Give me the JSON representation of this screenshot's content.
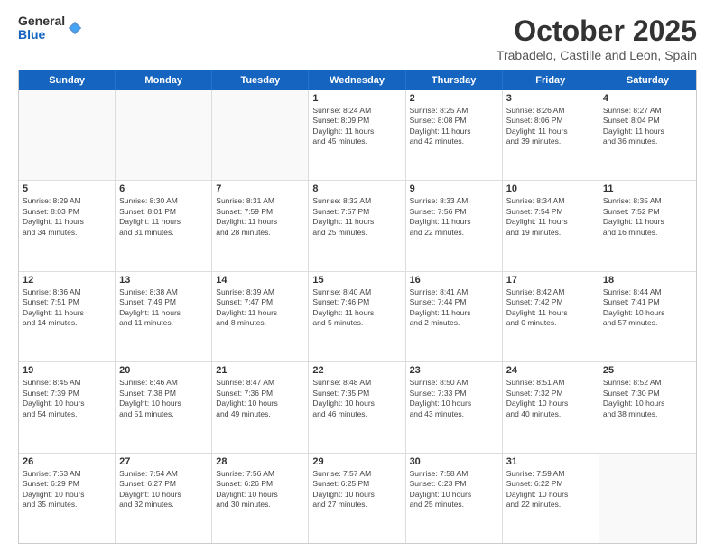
{
  "header": {
    "logo_general": "General",
    "logo_blue": "Blue",
    "month_title": "October 2025",
    "location": "Trabadelo, Castille and Leon, Spain"
  },
  "days_of_week": [
    "Sunday",
    "Monday",
    "Tuesday",
    "Wednesday",
    "Thursday",
    "Friday",
    "Saturday"
  ],
  "rows": [
    [
      {
        "day": "",
        "info": ""
      },
      {
        "day": "",
        "info": ""
      },
      {
        "day": "",
        "info": ""
      },
      {
        "day": "1",
        "info": "Sunrise: 8:24 AM\nSunset: 8:09 PM\nDaylight: 11 hours\nand 45 minutes."
      },
      {
        "day": "2",
        "info": "Sunrise: 8:25 AM\nSunset: 8:08 PM\nDaylight: 11 hours\nand 42 minutes."
      },
      {
        "day": "3",
        "info": "Sunrise: 8:26 AM\nSunset: 8:06 PM\nDaylight: 11 hours\nand 39 minutes."
      },
      {
        "day": "4",
        "info": "Sunrise: 8:27 AM\nSunset: 8:04 PM\nDaylight: 11 hours\nand 36 minutes."
      }
    ],
    [
      {
        "day": "5",
        "info": "Sunrise: 8:29 AM\nSunset: 8:03 PM\nDaylight: 11 hours\nand 34 minutes."
      },
      {
        "day": "6",
        "info": "Sunrise: 8:30 AM\nSunset: 8:01 PM\nDaylight: 11 hours\nand 31 minutes."
      },
      {
        "day": "7",
        "info": "Sunrise: 8:31 AM\nSunset: 7:59 PM\nDaylight: 11 hours\nand 28 minutes."
      },
      {
        "day": "8",
        "info": "Sunrise: 8:32 AM\nSunset: 7:57 PM\nDaylight: 11 hours\nand 25 minutes."
      },
      {
        "day": "9",
        "info": "Sunrise: 8:33 AM\nSunset: 7:56 PM\nDaylight: 11 hours\nand 22 minutes."
      },
      {
        "day": "10",
        "info": "Sunrise: 8:34 AM\nSunset: 7:54 PM\nDaylight: 11 hours\nand 19 minutes."
      },
      {
        "day": "11",
        "info": "Sunrise: 8:35 AM\nSunset: 7:52 PM\nDaylight: 11 hours\nand 16 minutes."
      }
    ],
    [
      {
        "day": "12",
        "info": "Sunrise: 8:36 AM\nSunset: 7:51 PM\nDaylight: 11 hours\nand 14 minutes."
      },
      {
        "day": "13",
        "info": "Sunrise: 8:38 AM\nSunset: 7:49 PM\nDaylight: 11 hours\nand 11 minutes."
      },
      {
        "day": "14",
        "info": "Sunrise: 8:39 AM\nSunset: 7:47 PM\nDaylight: 11 hours\nand 8 minutes."
      },
      {
        "day": "15",
        "info": "Sunrise: 8:40 AM\nSunset: 7:46 PM\nDaylight: 11 hours\nand 5 minutes."
      },
      {
        "day": "16",
        "info": "Sunrise: 8:41 AM\nSunset: 7:44 PM\nDaylight: 11 hours\nand 2 minutes."
      },
      {
        "day": "17",
        "info": "Sunrise: 8:42 AM\nSunset: 7:42 PM\nDaylight: 11 hours\nand 0 minutes."
      },
      {
        "day": "18",
        "info": "Sunrise: 8:44 AM\nSunset: 7:41 PM\nDaylight: 10 hours\nand 57 minutes."
      }
    ],
    [
      {
        "day": "19",
        "info": "Sunrise: 8:45 AM\nSunset: 7:39 PM\nDaylight: 10 hours\nand 54 minutes."
      },
      {
        "day": "20",
        "info": "Sunrise: 8:46 AM\nSunset: 7:38 PM\nDaylight: 10 hours\nand 51 minutes."
      },
      {
        "day": "21",
        "info": "Sunrise: 8:47 AM\nSunset: 7:36 PM\nDaylight: 10 hours\nand 49 minutes."
      },
      {
        "day": "22",
        "info": "Sunrise: 8:48 AM\nSunset: 7:35 PM\nDaylight: 10 hours\nand 46 minutes."
      },
      {
        "day": "23",
        "info": "Sunrise: 8:50 AM\nSunset: 7:33 PM\nDaylight: 10 hours\nand 43 minutes."
      },
      {
        "day": "24",
        "info": "Sunrise: 8:51 AM\nSunset: 7:32 PM\nDaylight: 10 hours\nand 40 minutes."
      },
      {
        "day": "25",
        "info": "Sunrise: 8:52 AM\nSunset: 7:30 PM\nDaylight: 10 hours\nand 38 minutes."
      }
    ],
    [
      {
        "day": "26",
        "info": "Sunrise: 7:53 AM\nSunset: 6:29 PM\nDaylight: 10 hours\nand 35 minutes."
      },
      {
        "day": "27",
        "info": "Sunrise: 7:54 AM\nSunset: 6:27 PM\nDaylight: 10 hours\nand 32 minutes."
      },
      {
        "day": "28",
        "info": "Sunrise: 7:56 AM\nSunset: 6:26 PM\nDaylight: 10 hours\nand 30 minutes."
      },
      {
        "day": "29",
        "info": "Sunrise: 7:57 AM\nSunset: 6:25 PM\nDaylight: 10 hours\nand 27 minutes."
      },
      {
        "day": "30",
        "info": "Sunrise: 7:58 AM\nSunset: 6:23 PM\nDaylight: 10 hours\nand 25 minutes."
      },
      {
        "day": "31",
        "info": "Sunrise: 7:59 AM\nSunset: 6:22 PM\nDaylight: 10 hours\nand 22 minutes."
      },
      {
        "day": "",
        "info": ""
      }
    ]
  ]
}
